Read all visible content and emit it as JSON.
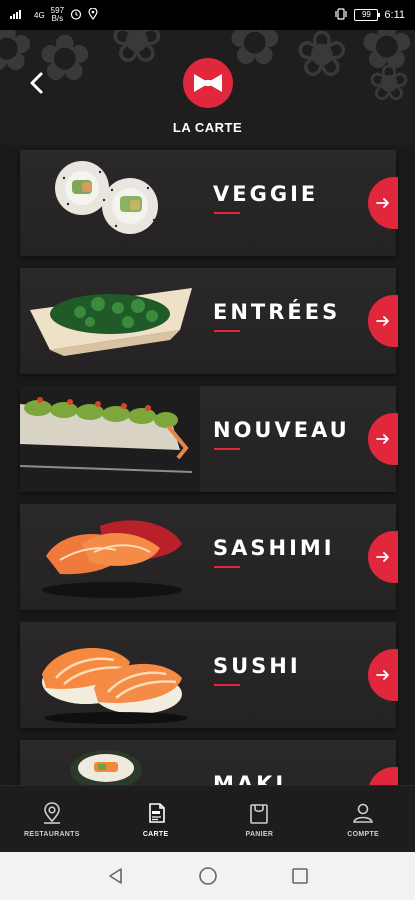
{
  "status_bar": {
    "signal": "4G",
    "speed_value": "597",
    "speed_unit": "B/s",
    "battery": "99",
    "time": "6:11"
  },
  "header": {
    "title": "LA CARTE",
    "back_icon": "chevron-left-icon",
    "logo_icon": "bowtie-logo"
  },
  "menu": {
    "items": [
      {
        "label": "VEGGIE"
      },
      {
        "label": "ENTRÉES"
      },
      {
        "label": "NOUVEAU"
      },
      {
        "label": "SASHIMI"
      },
      {
        "label": "SUSHI"
      },
      {
        "label": "MAKI"
      }
    ]
  },
  "bottom_nav": {
    "items": [
      {
        "label": "RESTAURANTS",
        "icon": "map-pin-icon"
      },
      {
        "label": "CARTE",
        "icon": "menu-book-icon"
      },
      {
        "label": "PANIER",
        "icon": "shopping-bag-icon"
      },
      {
        "label": "COMPTE",
        "icon": "user-icon"
      }
    ],
    "active": "CARTE"
  },
  "colors": {
    "accent": "#e0273c",
    "background": "#1c1a1b",
    "text": "#ffffff"
  }
}
